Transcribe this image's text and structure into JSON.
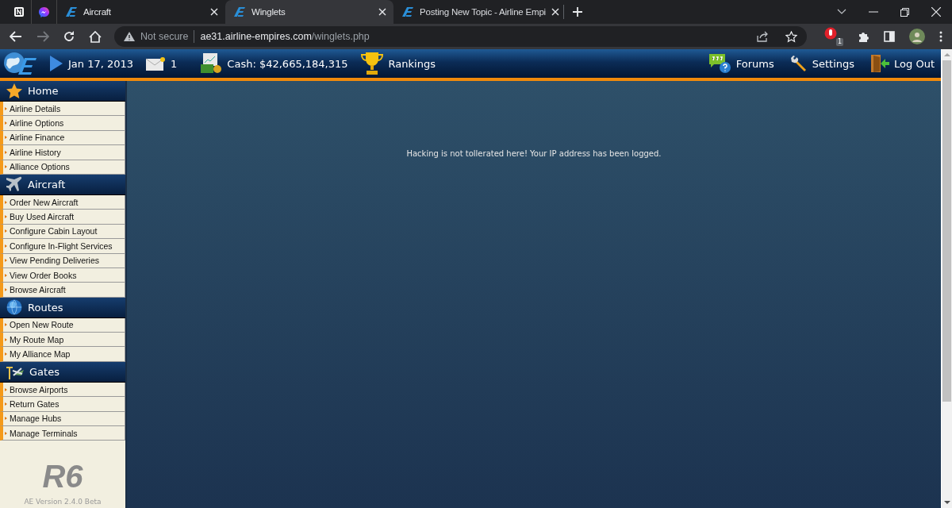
{
  "browser": {
    "tabs": [
      {
        "kind": "pinned-notion",
        "selected": false
      },
      {
        "kind": "pinned-messenger",
        "selected": false
      },
      {
        "kind": "page",
        "title": "Aircraft",
        "selected": false
      },
      {
        "kind": "page",
        "title": "Winglets",
        "selected": true
      },
      {
        "kind": "page",
        "title": "Posting New Topic - Airline Empi",
        "selected": false
      }
    ],
    "address": {
      "security": "Not secure",
      "host": "ae31.airline-empires.com",
      "path": "/winglets.php"
    },
    "extension_badge": "1"
  },
  "header": {
    "date": "Jan 17, 2013",
    "mail_count": "1",
    "cash": "Cash: $42,665,184,315",
    "rankings": "Rankings",
    "links": [
      {
        "kind": "forums",
        "label": "Forums"
      },
      {
        "kind": "settings",
        "label": "Settings"
      },
      {
        "kind": "logout",
        "label": "Log Out"
      }
    ]
  },
  "sidebar": {
    "sections": [
      {
        "kind": "home",
        "title": "Home",
        "items": [
          "Airline Details",
          "Airline Options",
          "Airline Finance",
          "Airline History",
          "Alliance Options"
        ]
      },
      {
        "kind": "aircraft",
        "title": "Aircraft",
        "items": [
          "Order New Aircraft",
          "Buy Used Aircraft",
          "Configure Cabin Layout",
          "Configure In-Flight Services",
          "View Pending Deliveries",
          "View Order Books",
          "Browse Aircraft"
        ]
      },
      {
        "kind": "routes",
        "title": "Routes",
        "items": [
          "Open New Route",
          "My Route Map",
          "My Alliance Map"
        ]
      },
      {
        "kind": "gates",
        "title": "Gates",
        "items": [
          "Browse Airports",
          "Return Gates",
          "Manage Hubs",
          "Manage Terminals"
        ]
      }
    ],
    "release": "R6",
    "version": "AE Version 2.4.0 Beta"
  },
  "message": "Hacking is not tollerated here! Your IP address has been logged."
}
